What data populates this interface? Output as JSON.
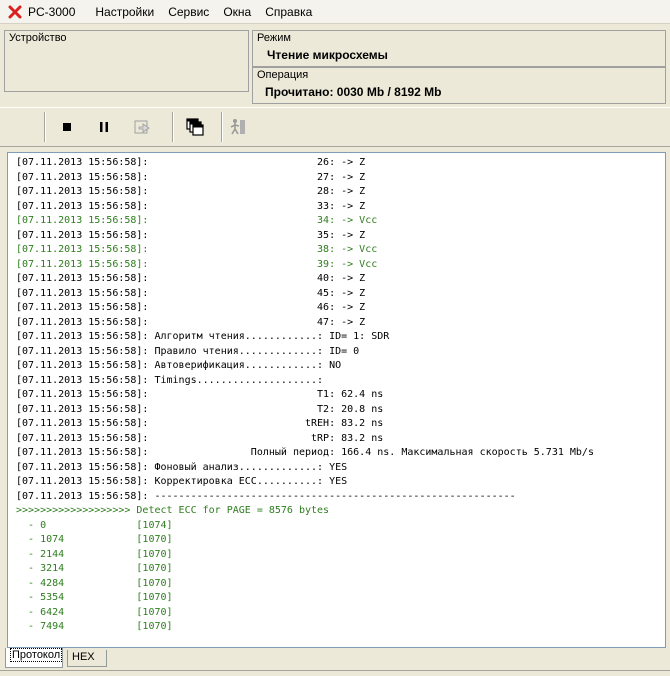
{
  "app": {
    "title": "PC-3000"
  },
  "menu": [
    "Настройки",
    "Сервис",
    "Окна",
    "Справка"
  ],
  "panels": {
    "device": {
      "label": "Устройство"
    },
    "mode": {
      "label": "Режим",
      "value": "Чтение микросхемы"
    },
    "operation": {
      "label": "Операция",
      "value": "Прочитано: 0030 Mb / 8192 Mb"
    }
  },
  "toolbar": {
    "buttons": [
      "stop-icon",
      "pause-icon",
      "import-icon",
      "windows-icon",
      "exit-icon"
    ]
  },
  "log": [
    {
      "text": "[07.11.2013 15:56:58]:                            26: -> Z",
      "color": "black"
    },
    {
      "text": "[07.11.2013 15:56:58]:                            27: -> Z",
      "color": "black"
    },
    {
      "text": "[07.11.2013 15:56:58]:                            28: -> Z",
      "color": "black"
    },
    {
      "text": "[07.11.2013 15:56:58]:                            33: -> Z",
      "color": "black"
    },
    {
      "text": "[07.11.2013 15:56:58]:                            34: -> Vcc",
      "color": "green"
    },
    {
      "text": "[07.11.2013 15:56:58]:                            35: -> Z",
      "color": "black"
    },
    {
      "text": "[07.11.2013 15:56:58]:                            38: -> Vcc",
      "color": "green"
    },
    {
      "text": "[07.11.2013 15:56:58]:                            39: -> Vcc",
      "color": "green"
    },
    {
      "text": "[07.11.2013 15:56:58]:                            40: -> Z",
      "color": "black"
    },
    {
      "text": "[07.11.2013 15:56:58]:                            45: -> Z",
      "color": "black"
    },
    {
      "text": "[07.11.2013 15:56:58]:                            46: -> Z",
      "color": "black"
    },
    {
      "text": "[07.11.2013 15:56:58]:                            47: -> Z",
      "color": "black"
    },
    {
      "text": "[07.11.2013 15:56:58]: Алгоритм чтения............: ID= 1: SDR",
      "color": "black"
    },
    {
      "text": "[07.11.2013 15:56:58]: Правило чтения.............: ID= 0",
      "color": "black"
    },
    {
      "text": "[07.11.2013 15:56:58]: Автоверификация............: NO",
      "color": "black"
    },
    {
      "text": "[07.11.2013 15:56:58]: Timings....................:",
      "color": "black"
    },
    {
      "text": "[07.11.2013 15:56:58]:                            T1: 62.4 ns",
      "color": "black"
    },
    {
      "text": "[07.11.2013 15:56:58]:                            T2: 20.8 ns",
      "color": "black"
    },
    {
      "text": "[07.11.2013 15:56:58]:                          tREH: 83.2 ns",
      "color": "black"
    },
    {
      "text": "[07.11.2013 15:56:58]:                           tRP: 83.2 ns",
      "color": "black"
    },
    {
      "text": "[07.11.2013 15:56:58]:                 Полный период: 166.4 ns. Максимальная скорость 5.731 Mb/s",
      "color": "black"
    },
    {
      "text": "[07.11.2013 15:56:58]: Фоновый анализ.............: YES",
      "color": "black"
    },
    {
      "text": "[07.11.2013 15:56:58]: Корректировка ECC..........: YES",
      "color": "black"
    },
    {
      "text": "[07.11.2013 15:56:58]: ------------------------------------------------------------",
      "color": "black"
    },
    {
      "text": ">>>>>>>>>>>>>>>>>>> Detect ECC for PAGE = 8576 bytes",
      "color": "green"
    },
    {
      "text": "  - 0               [1074]",
      "color": "green"
    },
    {
      "text": "  - 1074            [1070]",
      "color": "green"
    },
    {
      "text": "  - 2144            [1070]",
      "color": "green"
    },
    {
      "text": "  - 3214            [1070]",
      "color": "green"
    },
    {
      "text": "  - 4284            [1070]",
      "color": "green"
    },
    {
      "text": "  - 5354            [1070]",
      "color": "green"
    },
    {
      "text": "  - 6424            [1070]",
      "color": "green"
    },
    {
      "text": "  - 7494            [1070]",
      "color": "green"
    }
  ],
  "tabs": [
    {
      "label": "Протокол",
      "active": true
    },
    {
      "label": "HEX",
      "active": false
    }
  ],
  "colors": {
    "log_green": "#2e7d1e",
    "log_black": "#000000"
  }
}
